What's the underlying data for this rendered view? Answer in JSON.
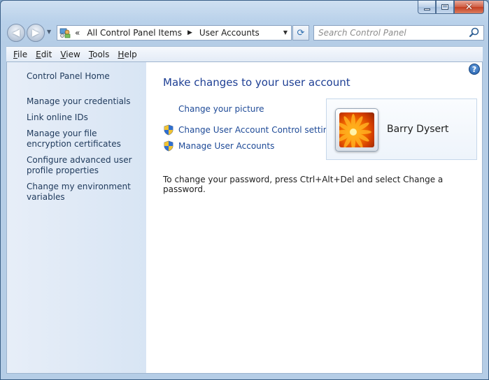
{
  "window": {
    "caption": {
      "minimize_icon": "minimize-icon",
      "maximize_icon": "maximize-icon",
      "close_icon": "close-icon"
    }
  },
  "nav": {
    "back_icon": "back-arrow-icon",
    "forward_icon": "forward-arrow-icon",
    "breadcrumb": [
      {
        "label": "All Control Panel Items"
      },
      {
        "label": "User Accounts"
      }
    ],
    "breadcrumb_overflow": "«",
    "search_placeholder": "Search Control Panel"
  },
  "menu": [
    {
      "accel": "F",
      "rest": "ile"
    },
    {
      "accel": "E",
      "rest": "dit"
    },
    {
      "accel": "V",
      "rest": "iew"
    },
    {
      "accel": "T",
      "rest": "ools"
    },
    {
      "accel": "H",
      "rest": "elp"
    }
  ],
  "sidebar": {
    "home": "Control Panel Home",
    "links": [
      "Manage your credentials",
      "Link online IDs",
      "Manage your file encryption certificates",
      "Configure advanced user profile properties",
      "Change my environment variables"
    ]
  },
  "main": {
    "help_label": "?",
    "heading": "Make changes to your user account",
    "tasks": [
      {
        "label": "Change your picture",
        "icon": ""
      },
      {
        "label": "Change User Account Control settings",
        "icon": "uac-shield-icon"
      },
      {
        "label": "Manage User Accounts",
        "icon": "uac-shield-icon"
      }
    ],
    "note": "To change your password, press Ctrl+Alt+Del and select Change a password.",
    "user": {
      "name": "Barry Dysert",
      "avatar_icon": "orange-flower-avatar"
    }
  },
  "colors": {
    "link": "#1e4a97",
    "heading": "#1e3f94",
    "sidebar_bg": "#dfe9f5",
    "window_frame": "#b9d1ea"
  }
}
